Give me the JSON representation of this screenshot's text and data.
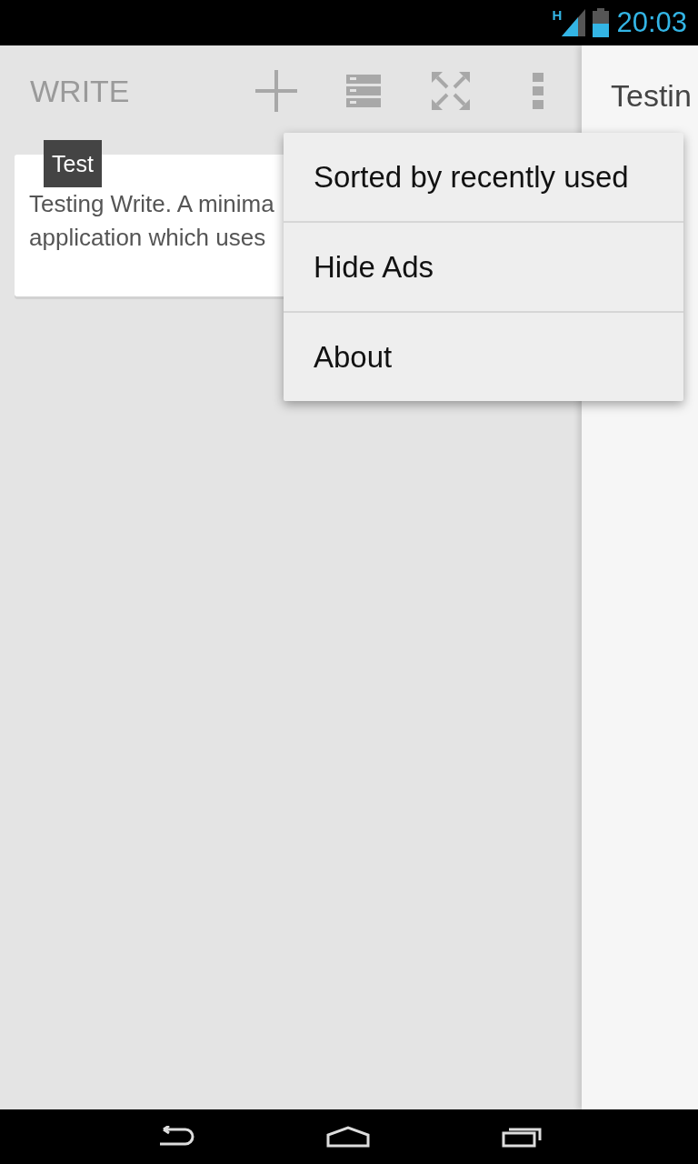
{
  "status_bar": {
    "network": "H",
    "time": "20:03"
  },
  "app_bar": {
    "title": "WRITE"
  },
  "notes": [
    {
      "tag": "Test",
      "lines": [
        "Testing Write. A minima",
        "application which uses"
      ]
    }
  ],
  "preview": {
    "text": "Testin"
  },
  "menu": [
    {
      "label": "Sorted by recently used"
    },
    {
      "label": "Hide Ads"
    },
    {
      "label": "About"
    }
  ]
}
